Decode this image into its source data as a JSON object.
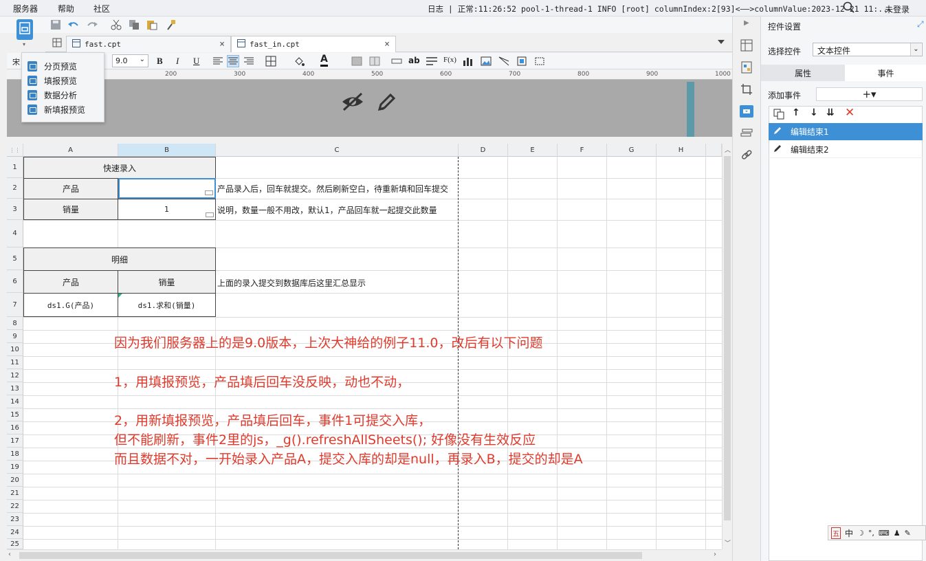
{
  "menubar": {
    "items": [
      "服务器",
      "帮助",
      "社区"
    ],
    "log": "日志 | 正常:11:26:52 pool-1-thread-1 INFO [root] columnIndex:2[93]<——>columnValue:2023-12-21 11:...",
    "login": "未登录"
  },
  "tabs": [
    {
      "label": "fast.cpt",
      "close": "×"
    },
    {
      "label": "fast_in.cpt",
      "close": "×"
    }
  ],
  "format": {
    "font_prefix": "宋",
    "font_size": "9.0"
  },
  "ruler_ticks": [
    "200",
    "300",
    "400",
    "500",
    "600",
    "700",
    "800",
    "900",
    "1000"
  ],
  "preview_menu": [
    "分页预览",
    "填报预览",
    "数据分析",
    "新填报预览"
  ],
  "grid": {
    "columns": [
      "A",
      "B",
      "C",
      "D",
      "E",
      "F",
      "G",
      "H"
    ],
    "rows": [
      "1",
      "2",
      "3",
      "4",
      "5",
      "6",
      "7",
      "8",
      "9",
      "10",
      "11",
      "12",
      "13",
      "14",
      "15",
      "16",
      "17",
      "18",
      "19",
      "20",
      "21",
      "22",
      "23",
      "24",
      "25"
    ],
    "cells": {
      "quick_entry": "快速录入",
      "product_label": "产品",
      "qty_label": "销量",
      "qty_value": "1",
      "note1": "产品录入后，回车就提交。然后刷新空白，待重新填和回车提交",
      "note2": "说明，数量一般不用改，默认1，产品回车就一起提交此数量",
      "detail": "明细",
      "detail_product": "产品",
      "detail_qty": "销量",
      "note3": "上面的录入提交到数据库后这里汇总显示",
      "ds_product": "ds1.G(产品)",
      "ds_qty": "ds1.求和(销量)"
    }
  },
  "annotation": [
    "因为我们服务器上的是9.0版本，上次大神给的例子11.0，改后有以下问题",
    "1，用填报预览，产品填后回车没反映，动也不动，",
    "2，用新填报预览，产品填后回车，事件1可提交入库，",
    "但不能刷新，事件2里的js，_g().refreshAllSheets();  好像没有生效反应",
    "而且数据不对，一开始录入产品A，提交入库的却是null，再录入B，提交的却是A"
  ],
  "panel": {
    "title": "控件设置",
    "select_label": "选择控件",
    "select_value": "文本控件",
    "tab_props": "属性",
    "tab_events": "事件",
    "add_event": "添加事件",
    "add_symbol": "+▾",
    "events": [
      "编辑结束1",
      "编辑结束2"
    ]
  },
  "ime": [
    "五",
    "中",
    "☽",
    "°,",
    "⌨",
    "♟",
    "✎"
  ],
  "colors": {
    "accent": "#3d8fd6",
    "selected_row": "#3d8fd6",
    "annotation": "#e03a2c",
    "delete": "#e03a2c"
  }
}
